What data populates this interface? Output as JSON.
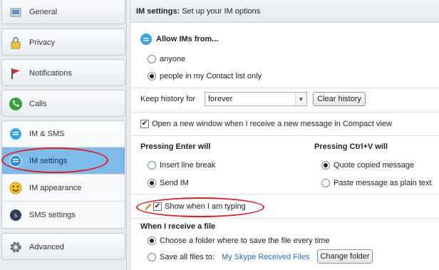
{
  "sidebar": {
    "general": "General",
    "privacy": "Privacy",
    "notifications": "Notifications",
    "calls": "Calls",
    "im_sms": "IM & SMS",
    "im_settings": "IM settings",
    "im_appearance": "IM appearance",
    "sms_settings": "SMS settings",
    "advanced": "Advanced"
  },
  "header": {
    "title": "IM settings:",
    "subtitle": "Set up your IM options"
  },
  "allow": {
    "title": "Allow IMs from...",
    "opt_anyone": "anyone",
    "opt_contacts": "people in my Contact list only",
    "selected": "people in my Contact list only"
  },
  "history": {
    "label": "Keep history for",
    "value": "forever",
    "clear_button": "Clear history"
  },
  "compact": {
    "label": "Open a new window when I receive a new message in Compact view",
    "checked": true
  },
  "enter": {
    "title": "Pressing Enter will",
    "opt_line_break": "Insert line break",
    "opt_send": "Send IM",
    "selected": "Send IM"
  },
  "paste": {
    "title": "Pressing Ctrl+V will",
    "opt_quote": "Quote copied message",
    "opt_plain": "Paste message as plain text",
    "selected": "Quote copied message"
  },
  "typing": {
    "label": "Show when I am typing",
    "checked": true
  },
  "file": {
    "title": "When I receive a file",
    "opt_choose": "Choose a folder where to save the file every time",
    "opt_save_all": "Save all files to:",
    "folder": "My Skype Received Files",
    "change_button": "Change folder",
    "selected": "Choose a folder where to save the file every time"
  },
  "colors": {
    "highlight": "#d81e2a",
    "selected_bg": "#7fbbe8",
    "link": "#2a6bb5"
  }
}
